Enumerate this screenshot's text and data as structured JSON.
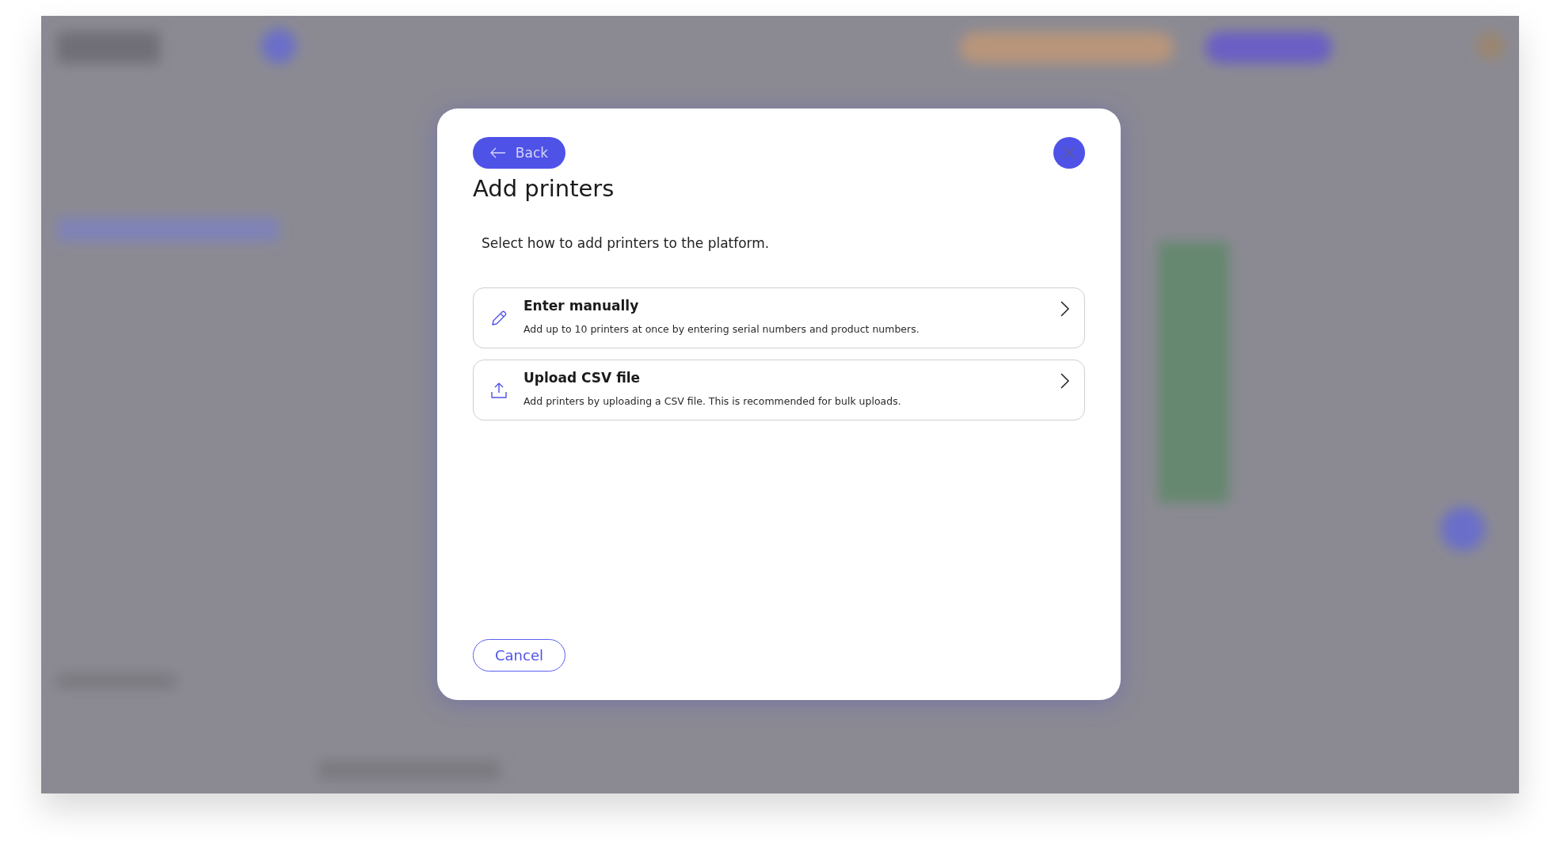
{
  "dialog": {
    "back_button": {
      "label": "Back"
    },
    "title": "Add printers",
    "description": "Select how to add printers to the platform.",
    "options": [
      {
        "kind": "pencil",
        "title": "Enter manually",
        "description": "Add up to 10 printers at once by entering serial numbers and product numbers."
      },
      {
        "kind": "upload",
        "title": "Upload CSV file",
        "description": "Add printers by uploading a CSV file. This is recommended for bulk uploads."
      }
    ],
    "cancel_button": {
      "label": "Cancel"
    }
  }
}
